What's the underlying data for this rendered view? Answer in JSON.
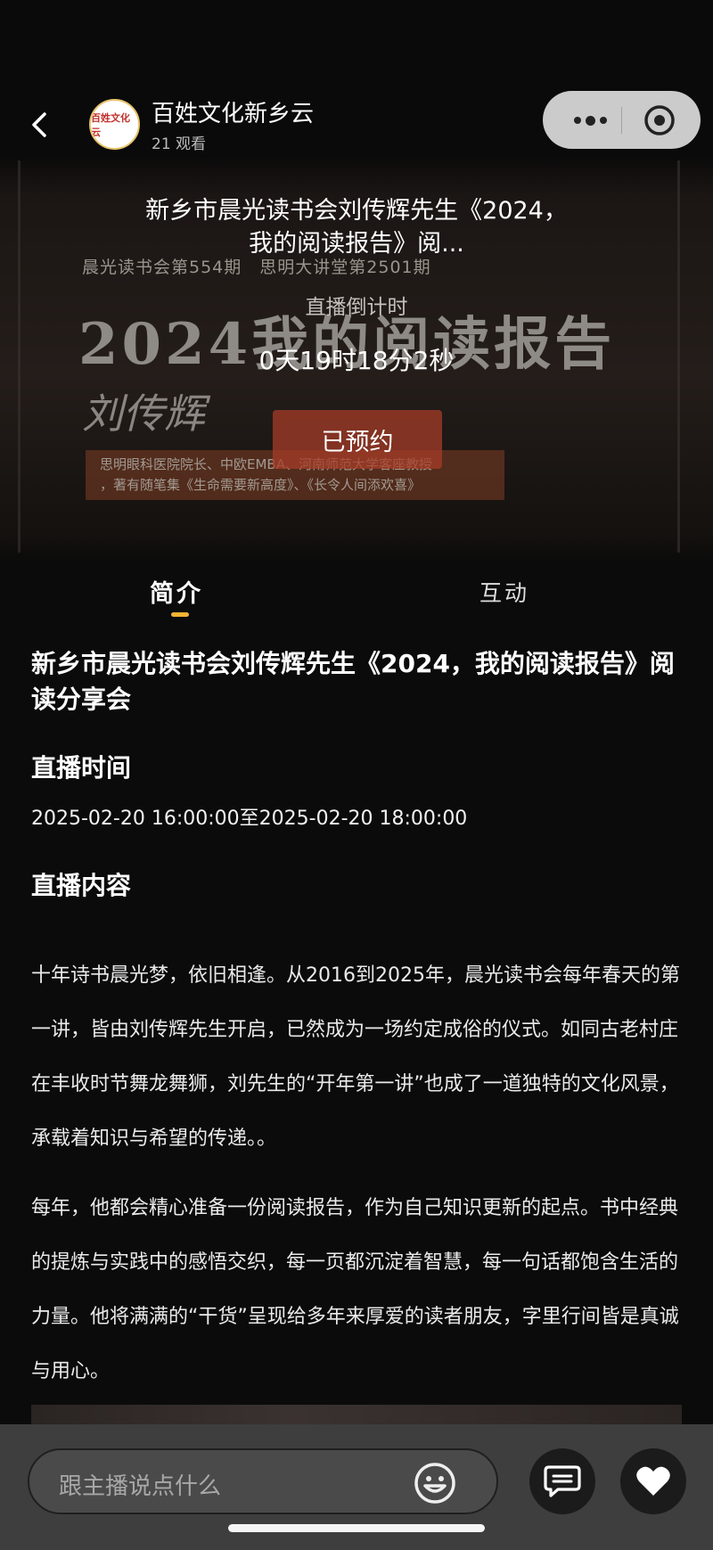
{
  "header": {
    "channel_name": "百姓文化新乡云",
    "viewers": "21 观看",
    "avatar_text": "百姓文化云"
  },
  "poster": {
    "line1": "晨光读书会第554期　思明大讲堂第2501期",
    "year_title": "2024我的阅读报告",
    "speaker": "刘传辉",
    "sub1": "思明眼科医院院长、中欧EMBA、河南师范大学客座教授",
    "sub2": "，著有随笔集《生命需要新高度》、《长令人间添欢喜》"
  },
  "live": {
    "title": "新乡市晨光读书会刘传辉先生《2024，我的阅读报告》阅...",
    "countdown_label": "直播倒计时",
    "countdown": "0天19时18分2秒",
    "reserve_label": "已预约"
  },
  "tabs": [
    {
      "label": "简介",
      "active": true
    },
    {
      "label": "互动",
      "active": false
    }
  ],
  "detail": {
    "event_title": "新乡市晨光读书会刘传辉先生《2024，我的阅读报告》阅读分享会",
    "time_heading": "直播时间",
    "time_value": "2025-02-20 16:00:00至2025-02-20 18:00:00",
    "content_heading": "直播内容",
    "paragraph1": "十年诗书晨光梦，依旧相逢。从2016到2025年，晨光读书会每年春天的第一讲，皆由刘传辉先生开启，已然成为一场约定成俗的仪式。如同古老村庄在丰收时节舞龙舞狮，刘先生的“开年第一讲”也成了一道独特的文化风景，承载着知识与希望的传递。。",
    "paragraph2": "每年，他都会精心准备一份阅读报告，作为自己知识更新的起点。书中经典的提炼与实践中的感悟交织，每一页都沉淀着智慧，每一句话都饱含生活的力量。他将满满的“干货”呈现给多年来厚爱的读者朋友，字里行间皆是真诚与用心。"
  },
  "bottom": {
    "comment_placeholder": "跟主播说点什么"
  },
  "colors": {
    "accent": "#f2b431",
    "reserve_button": "#a53c28",
    "background": "#0b0b0b"
  }
}
